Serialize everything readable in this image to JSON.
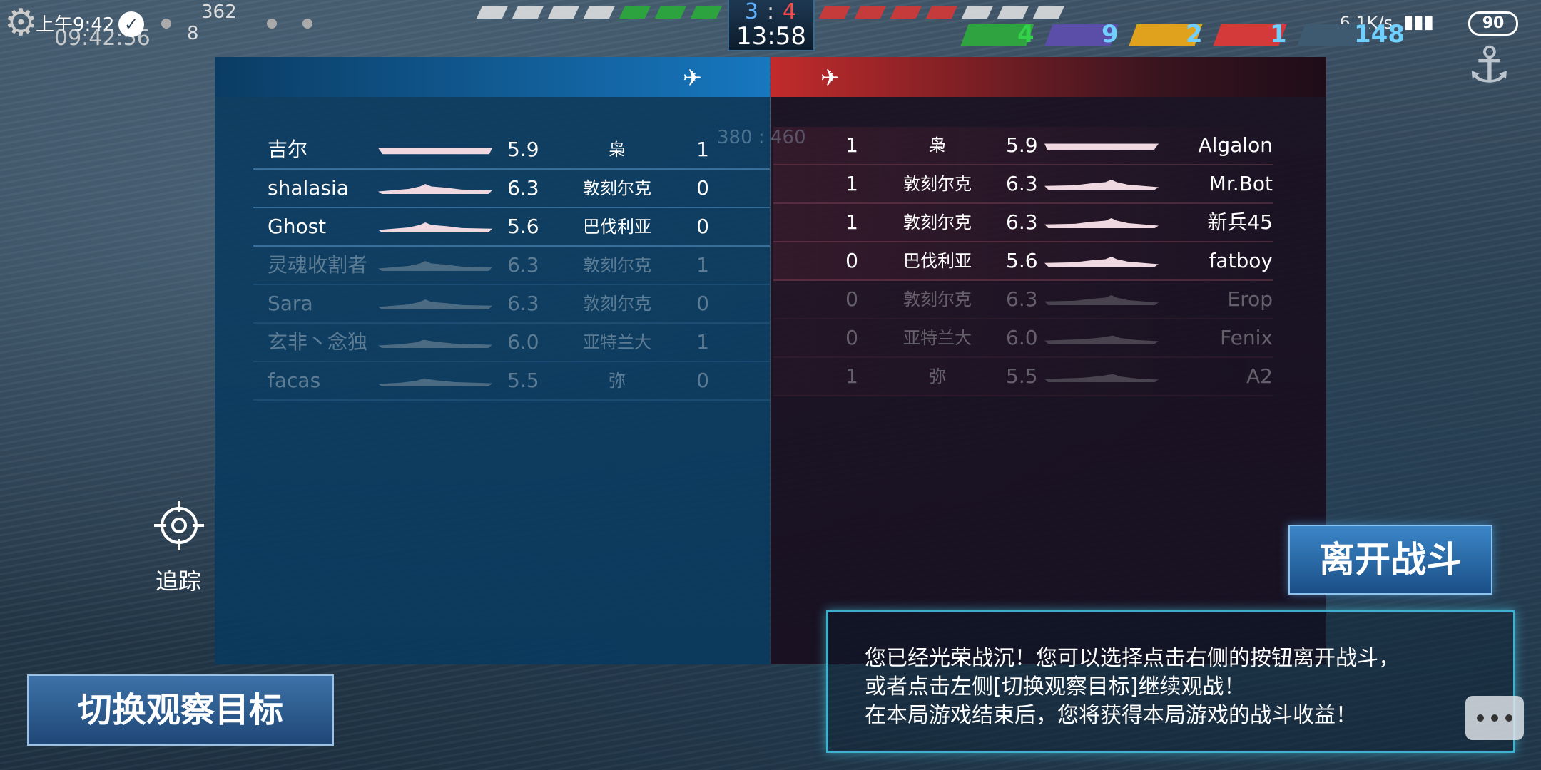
{
  "status_bar": {
    "time": "上午9:42",
    "clock": "09:42:56",
    "count_top": "362",
    "count_bottom": "8",
    "net_speed": "6.1K/s",
    "battery": "90"
  },
  "hud": {
    "score_blue": "3",
    "score_sep": ":",
    "score_red": "4",
    "timer": "13:58",
    "ghost_score": "380 : 460"
  },
  "resources": [
    {
      "value": "4",
      "color": "#2fa33f",
      "num_color": "#33d04a"
    },
    {
      "value": "9",
      "color": "#5b4ea8",
      "num_color": "#6fd0ff"
    },
    {
      "value": "2",
      "color": "#e0a21c",
      "num_color": "#6fd0ff"
    },
    {
      "value": "1",
      "color": "#d43a3a",
      "num_color": "#6fd0ff"
    },
    {
      "value": "148",
      "color": "#3d5a70",
      "num_color": "#6fd0ff"
    }
  ],
  "blue_team": [
    {
      "name": "吉尔",
      "rating": "5.9",
      "ship": "枭",
      "kills": "1",
      "alive": true,
      "ship_type": "carrier"
    },
    {
      "name": "shalasia",
      "rating": "6.3",
      "ship": "敦刻尔克",
      "kills": "0",
      "alive": true,
      "ship_type": "battleship"
    },
    {
      "name": "Ghost",
      "rating": "5.6",
      "ship": "巴伐利亚",
      "kills": "0",
      "alive": true,
      "ship_type": "battleship"
    },
    {
      "name": "灵魂收割者",
      "rating": "6.3",
      "ship": "敦刻尔克",
      "kills": "1",
      "alive": false,
      "ship_type": "battleship"
    },
    {
      "name": "Sara",
      "rating": "6.3",
      "ship": "敦刻尔克",
      "kills": "0",
      "alive": false,
      "ship_type": "battleship"
    },
    {
      "name": "玄非丶念独",
      "rating": "6.0",
      "ship": "亚特兰大",
      "kills": "1",
      "alive": false,
      "ship_type": "cruiser"
    },
    {
      "name": "facas",
      "rating": "5.5",
      "ship": "弥",
      "kills": "0",
      "alive": false,
      "ship_type": "cruiser"
    }
  ],
  "red_team": [
    {
      "name": "Algalon",
      "rating": "5.9",
      "ship": "枭",
      "kills": "1",
      "alive": true,
      "ship_type": "carrier"
    },
    {
      "name": "Mr.Bot",
      "rating": "6.3",
      "ship": "敦刻尔克",
      "kills": "1",
      "alive": true,
      "ship_type": "battleship"
    },
    {
      "name": "新兵45",
      "rating": "6.3",
      "ship": "敦刻尔克",
      "kills": "1",
      "alive": true,
      "ship_type": "battleship"
    },
    {
      "name": "fatboy",
      "rating": "5.6",
      "ship": "巴伐利亚",
      "kills": "0",
      "alive": true,
      "ship_type": "battleship"
    },
    {
      "name": "Erop",
      "rating": "6.3",
      "ship": "敦刻尔克",
      "kills": "0",
      "alive": false,
      "ship_type": "battleship"
    },
    {
      "name": "Fenix",
      "rating": "6.0",
      "ship": "亚特兰大",
      "kills": "0",
      "alive": false,
      "ship_type": "cruiser"
    },
    {
      "name": "A2",
      "rating": "5.5",
      "ship": "弥",
      "kills": "1",
      "alive": false,
      "ship_type": "cruiser"
    }
  ],
  "buttons": {
    "leave": "离开战斗",
    "switch_target": "切换观察目标",
    "track": "追踪"
  },
  "message": {
    "line1": "您已经光荣战沉！您可以选择点击右侧的按钮离开战斗，",
    "line2": "或者点击左侧[切换观察目标]继续观战！",
    "line3": "在本局游戏结束后，您将获得本局游戏的战斗收益！"
  },
  "icons": {
    "settings": "gear-icon",
    "track": "crosshair-icon",
    "chat": "chat-bubble-icon",
    "anchor": "anchor-icon",
    "team_header": "aircraft-icon"
  }
}
